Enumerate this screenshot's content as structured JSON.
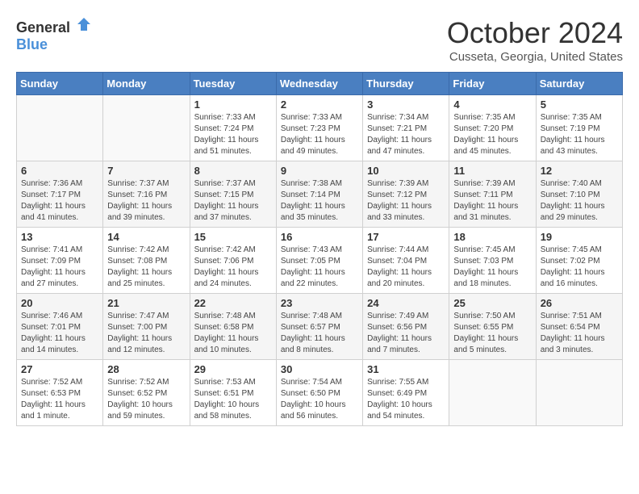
{
  "header": {
    "logo_general": "General",
    "logo_blue": "Blue",
    "month": "October 2024",
    "location": "Cusseta, Georgia, United States"
  },
  "weekdays": [
    "Sunday",
    "Monday",
    "Tuesday",
    "Wednesday",
    "Thursday",
    "Friday",
    "Saturday"
  ],
  "weeks": [
    [
      {
        "day": "",
        "sunrise": "",
        "sunset": "",
        "daylight": ""
      },
      {
        "day": "",
        "sunrise": "",
        "sunset": "",
        "daylight": ""
      },
      {
        "day": "1",
        "sunrise": "Sunrise: 7:33 AM",
        "sunset": "Sunset: 7:24 PM",
        "daylight": "Daylight: 11 hours and 51 minutes."
      },
      {
        "day": "2",
        "sunrise": "Sunrise: 7:33 AM",
        "sunset": "Sunset: 7:23 PM",
        "daylight": "Daylight: 11 hours and 49 minutes."
      },
      {
        "day": "3",
        "sunrise": "Sunrise: 7:34 AM",
        "sunset": "Sunset: 7:21 PM",
        "daylight": "Daylight: 11 hours and 47 minutes."
      },
      {
        "day": "4",
        "sunrise": "Sunrise: 7:35 AM",
        "sunset": "Sunset: 7:20 PM",
        "daylight": "Daylight: 11 hours and 45 minutes."
      },
      {
        "day": "5",
        "sunrise": "Sunrise: 7:35 AM",
        "sunset": "Sunset: 7:19 PM",
        "daylight": "Daylight: 11 hours and 43 minutes."
      }
    ],
    [
      {
        "day": "6",
        "sunrise": "Sunrise: 7:36 AM",
        "sunset": "Sunset: 7:17 PM",
        "daylight": "Daylight: 11 hours and 41 minutes."
      },
      {
        "day": "7",
        "sunrise": "Sunrise: 7:37 AM",
        "sunset": "Sunset: 7:16 PM",
        "daylight": "Daylight: 11 hours and 39 minutes."
      },
      {
        "day": "8",
        "sunrise": "Sunrise: 7:37 AM",
        "sunset": "Sunset: 7:15 PM",
        "daylight": "Daylight: 11 hours and 37 minutes."
      },
      {
        "day": "9",
        "sunrise": "Sunrise: 7:38 AM",
        "sunset": "Sunset: 7:14 PM",
        "daylight": "Daylight: 11 hours and 35 minutes."
      },
      {
        "day": "10",
        "sunrise": "Sunrise: 7:39 AM",
        "sunset": "Sunset: 7:12 PM",
        "daylight": "Daylight: 11 hours and 33 minutes."
      },
      {
        "day": "11",
        "sunrise": "Sunrise: 7:39 AM",
        "sunset": "Sunset: 7:11 PM",
        "daylight": "Daylight: 11 hours and 31 minutes."
      },
      {
        "day": "12",
        "sunrise": "Sunrise: 7:40 AM",
        "sunset": "Sunset: 7:10 PM",
        "daylight": "Daylight: 11 hours and 29 minutes."
      }
    ],
    [
      {
        "day": "13",
        "sunrise": "Sunrise: 7:41 AM",
        "sunset": "Sunset: 7:09 PM",
        "daylight": "Daylight: 11 hours and 27 minutes."
      },
      {
        "day": "14",
        "sunrise": "Sunrise: 7:42 AM",
        "sunset": "Sunset: 7:08 PM",
        "daylight": "Daylight: 11 hours and 25 minutes."
      },
      {
        "day": "15",
        "sunrise": "Sunrise: 7:42 AM",
        "sunset": "Sunset: 7:06 PM",
        "daylight": "Daylight: 11 hours and 24 minutes."
      },
      {
        "day": "16",
        "sunrise": "Sunrise: 7:43 AM",
        "sunset": "Sunset: 7:05 PM",
        "daylight": "Daylight: 11 hours and 22 minutes."
      },
      {
        "day": "17",
        "sunrise": "Sunrise: 7:44 AM",
        "sunset": "Sunset: 7:04 PM",
        "daylight": "Daylight: 11 hours and 20 minutes."
      },
      {
        "day": "18",
        "sunrise": "Sunrise: 7:45 AM",
        "sunset": "Sunset: 7:03 PM",
        "daylight": "Daylight: 11 hours and 18 minutes."
      },
      {
        "day": "19",
        "sunrise": "Sunrise: 7:45 AM",
        "sunset": "Sunset: 7:02 PM",
        "daylight": "Daylight: 11 hours and 16 minutes."
      }
    ],
    [
      {
        "day": "20",
        "sunrise": "Sunrise: 7:46 AM",
        "sunset": "Sunset: 7:01 PM",
        "daylight": "Daylight: 11 hours and 14 minutes."
      },
      {
        "day": "21",
        "sunrise": "Sunrise: 7:47 AM",
        "sunset": "Sunset: 7:00 PM",
        "daylight": "Daylight: 11 hours and 12 minutes."
      },
      {
        "day": "22",
        "sunrise": "Sunrise: 7:48 AM",
        "sunset": "Sunset: 6:58 PM",
        "daylight": "Daylight: 11 hours and 10 minutes."
      },
      {
        "day": "23",
        "sunrise": "Sunrise: 7:48 AM",
        "sunset": "Sunset: 6:57 PM",
        "daylight": "Daylight: 11 hours and 8 minutes."
      },
      {
        "day": "24",
        "sunrise": "Sunrise: 7:49 AM",
        "sunset": "Sunset: 6:56 PM",
        "daylight": "Daylight: 11 hours and 7 minutes."
      },
      {
        "day": "25",
        "sunrise": "Sunrise: 7:50 AM",
        "sunset": "Sunset: 6:55 PM",
        "daylight": "Daylight: 11 hours and 5 minutes."
      },
      {
        "day": "26",
        "sunrise": "Sunrise: 7:51 AM",
        "sunset": "Sunset: 6:54 PM",
        "daylight": "Daylight: 11 hours and 3 minutes."
      }
    ],
    [
      {
        "day": "27",
        "sunrise": "Sunrise: 7:52 AM",
        "sunset": "Sunset: 6:53 PM",
        "daylight": "Daylight: 11 hours and 1 minute."
      },
      {
        "day": "28",
        "sunrise": "Sunrise: 7:52 AM",
        "sunset": "Sunset: 6:52 PM",
        "daylight": "Daylight: 10 hours and 59 minutes."
      },
      {
        "day": "29",
        "sunrise": "Sunrise: 7:53 AM",
        "sunset": "Sunset: 6:51 PM",
        "daylight": "Daylight: 10 hours and 58 minutes."
      },
      {
        "day": "30",
        "sunrise": "Sunrise: 7:54 AM",
        "sunset": "Sunset: 6:50 PM",
        "daylight": "Daylight: 10 hours and 56 minutes."
      },
      {
        "day": "31",
        "sunrise": "Sunrise: 7:55 AM",
        "sunset": "Sunset: 6:49 PM",
        "daylight": "Daylight: 10 hours and 54 minutes."
      },
      {
        "day": "",
        "sunrise": "",
        "sunset": "",
        "daylight": ""
      },
      {
        "day": "",
        "sunrise": "",
        "sunset": "",
        "daylight": ""
      }
    ]
  ]
}
